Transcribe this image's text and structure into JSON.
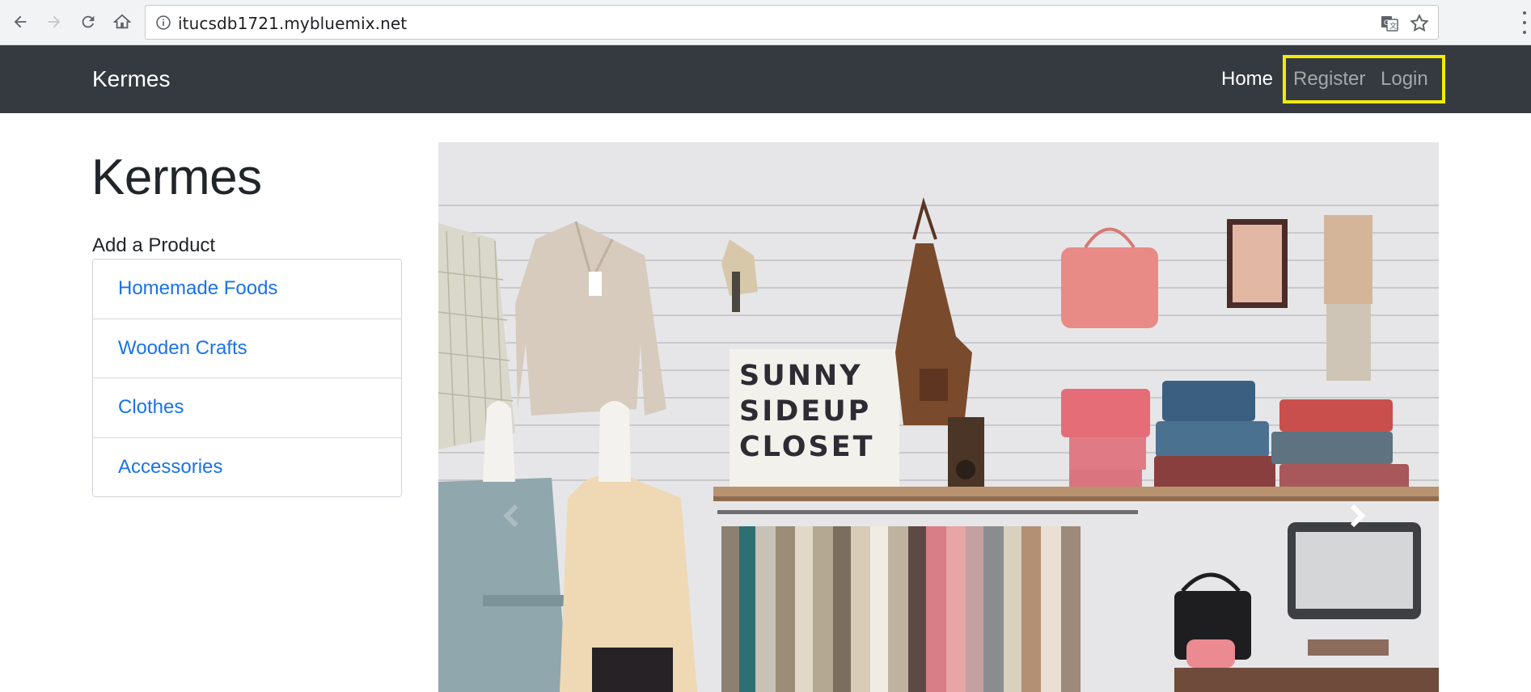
{
  "browser": {
    "url": "itucsdb1721.mybluemix.net",
    "icons": [
      "back-icon",
      "forward-icon",
      "reload-icon",
      "home-icon",
      "info-icon",
      "translate-icon",
      "star-icon",
      "menu-icon"
    ]
  },
  "navbar": {
    "brand": "Kermes",
    "links": [
      "Home",
      "Register",
      "Login"
    ],
    "highlight_color": "#f2ea0a",
    "background": "#343a40"
  },
  "sidebar": {
    "title": "Kermes",
    "section_label": "Add a Product",
    "categories": [
      "Homemade Foods",
      "Wooden Crafts",
      "Clothes",
      "Accessories"
    ],
    "link_color": "#1a73e8"
  },
  "carousel": {
    "sign_lines": [
      "SUNNY",
      "SIDEUP",
      "CLOSET"
    ],
    "controls": [
      "previous-icon",
      "next-icon"
    ]
  }
}
